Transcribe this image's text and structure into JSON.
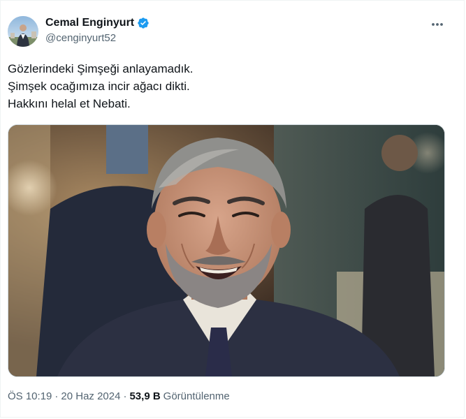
{
  "author": {
    "display_name": "Cemal Enginyurt",
    "handle": "@cenginyurt52",
    "verified": true,
    "verified_color": "#1d9bf0"
  },
  "tweet": {
    "lines": [
      "Gözlerindeki Şimşeği anlayamadık.",
      "Şimşek ocağımıza incir ağacı dikti.",
      "Hakkını helal et Nebati."
    ]
  },
  "media": {
    "icon": "photo"
  },
  "footer": {
    "time": "ÖS 10:19",
    "separator": "·",
    "date": "20 Haz 2024",
    "views_count": "53,9 B",
    "views_label": "Görüntülenme"
  },
  "icons": {
    "more": "more-horizontal-icon",
    "verified": "verified-badge-icon"
  }
}
